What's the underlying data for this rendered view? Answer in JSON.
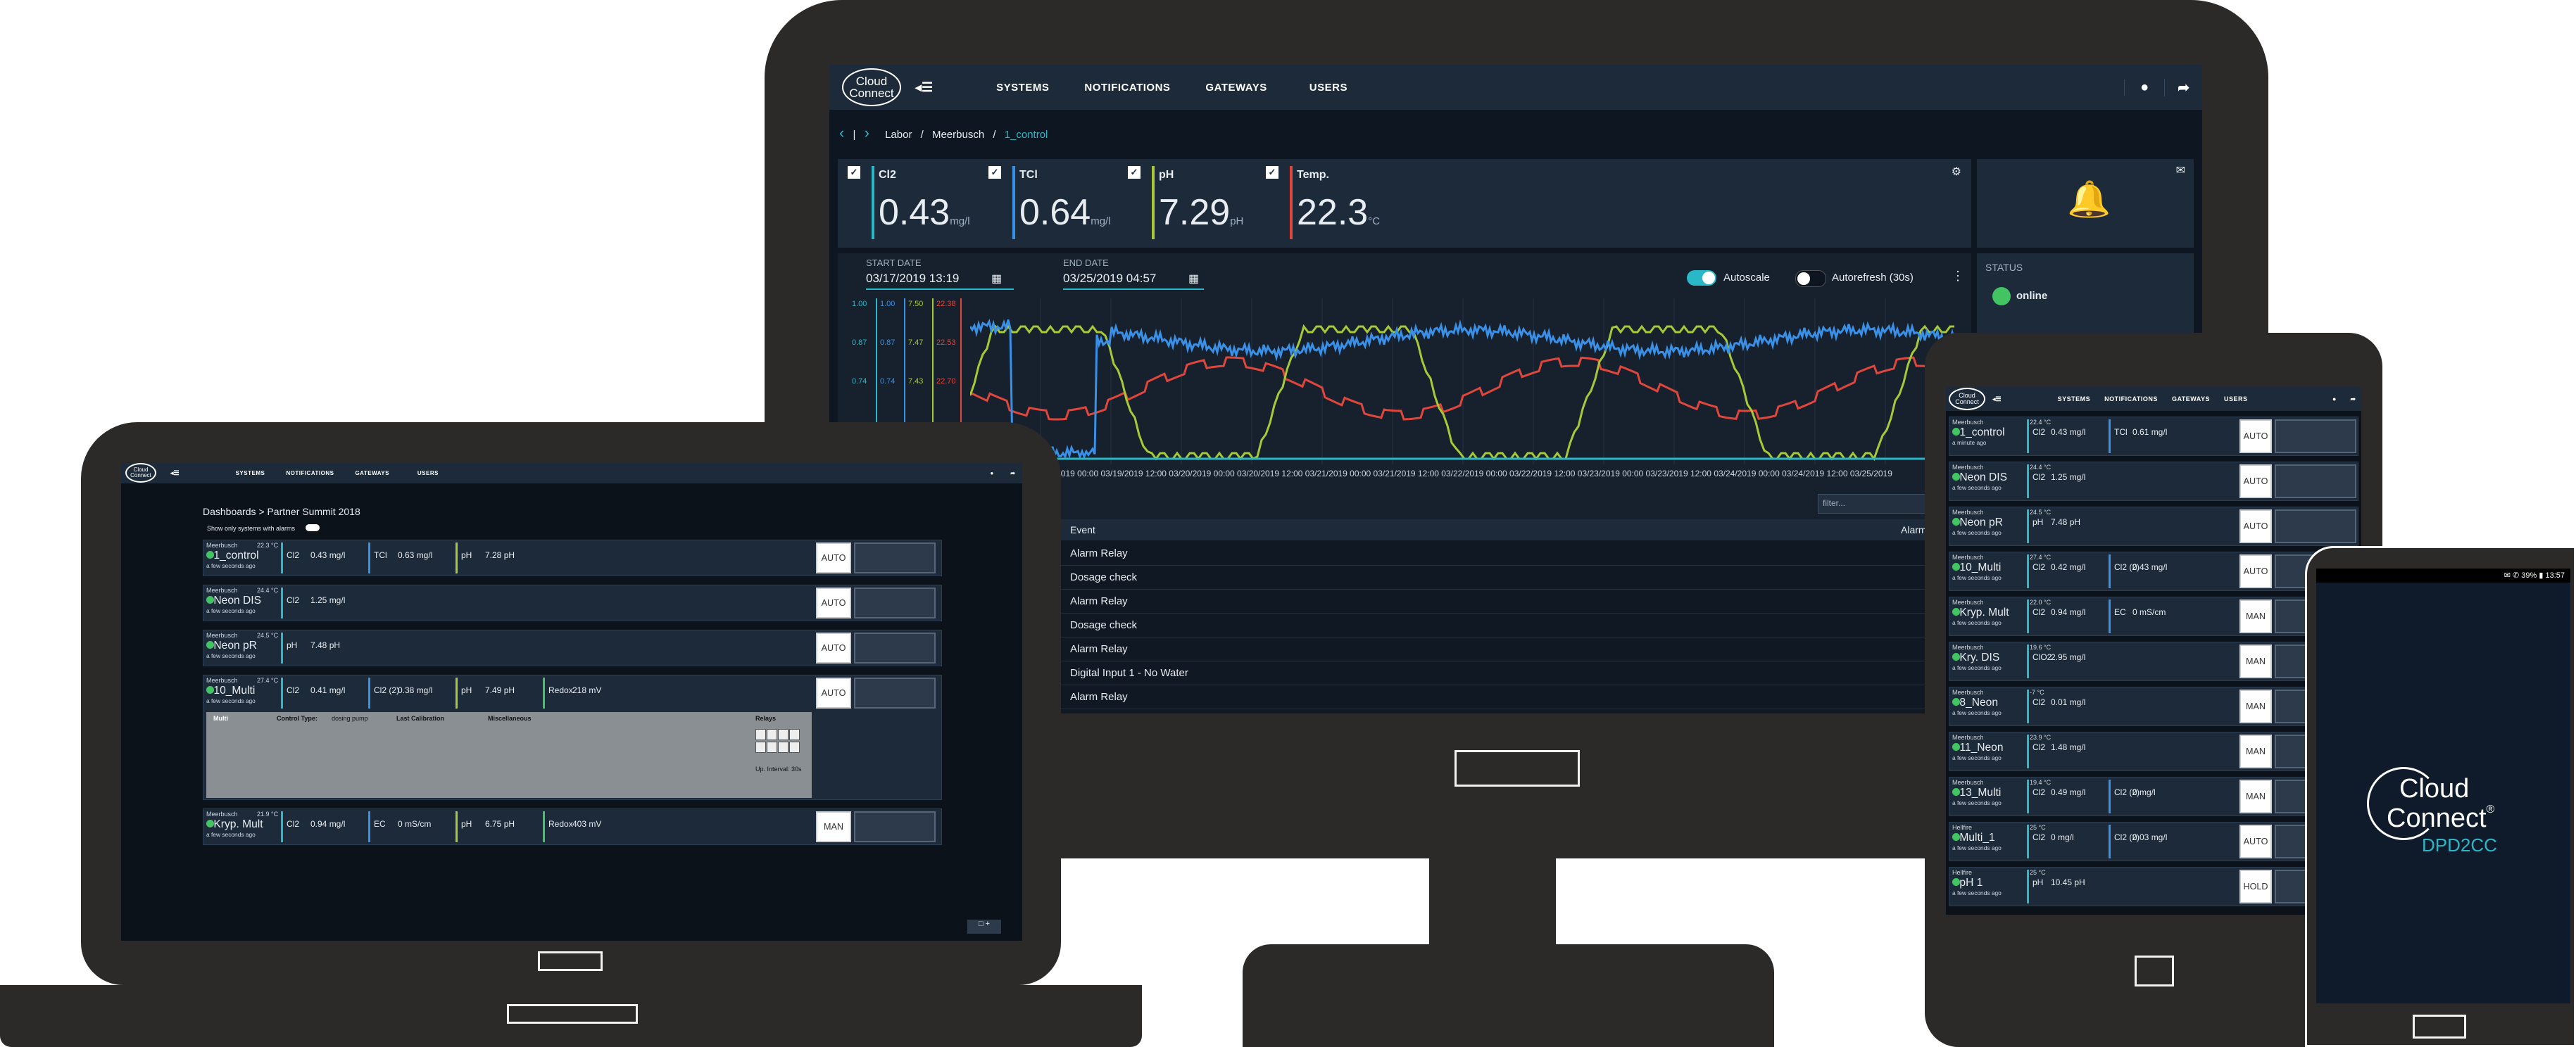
{
  "brand": {
    "line1": "Cloud",
    "line2": "Connect",
    "tm": "®",
    "product": "DPD2CC"
  },
  "nav": {
    "menu_icon": "◂☰",
    "systems": "SYSTEMS",
    "notifications": "NOTIFICATIONS",
    "gateways": "GATEWAYS",
    "users": "USERS"
  },
  "monitor": {
    "breadcrumb": {
      "prev": "‹",
      "sep1": "|",
      "next": "›",
      "c1": "Labor",
      "s1": "/",
      "c2": "Meerbusch",
      "s2": "/",
      "c3": "1_control"
    },
    "readings": [
      {
        "label": "Cl2",
        "value": "0.43",
        "unit": "mg/l",
        "color": "#2ab7c8"
      },
      {
        "label": "TCl",
        "value": "0.64",
        "unit": "mg/l",
        "color": "#3a8fe6"
      },
      {
        "label": "pH",
        "value": "7.29",
        "unit": "pH",
        "color": "#a7c937"
      },
      {
        "label": "Temp.",
        "value": "22.3",
        "unit": "°C",
        "color": "#e0463b"
      }
    ],
    "start_label": "START DATE",
    "start_value": "03/17/2019 13:19",
    "end_label": "END DATE",
    "end_value": "03/25/2019 04:57",
    "autoscale": "Autoscale",
    "autorefresh": "Autorefresh (30s)",
    "status_label": "STATUS",
    "status_value": "online",
    "axis_rows": [
      [
        "1.00",
        "1.00",
        "7.50",
        "22.38"
      ],
      [
        "0.87",
        "0.87",
        "7.47",
        "22.53"
      ],
      [
        "0.74",
        "0.74",
        "7.43",
        "22.70"
      ]
    ],
    "x_ticks": "03/18/2019 12:00 03/19/2019 00:00 03/19/2019 12:00 03/20/2019 00:00 03/20/2019 12:00 03/21/2019 00:00 03/21/2019 12:00 03/22/2019 00:00 03/22/2019 12:00 03/23/2019 00:00 03/23/2019 12:00 03/24/2019 00:00 03/24/2019 12:00 03/25/2019",
    "filter_placeholder": "filter...",
    "event_header": "Event",
    "alarm_header": "Alarm",
    "events": [
      "Alarm Relay",
      "Dosage check",
      "Alarm Relay",
      "Dosage check",
      "Alarm Relay",
      "Digital Input 1 - No Water",
      "Alarm Relay"
    ]
  },
  "laptop": {
    "title": "Dashboards > Partner Summit 2018",
    "toggle_label": "Show only systems with alarms",
    "systems": [
      {
        "site": "Meerbusch",
        "temp": "22.3 °C",
        "name": "1_control",
        "ago": "a few seconds ago",
        "m1": "Cl2",
        "v1": "0.43 mg/l",
        "m2": "TCl",
        "v2": "0.63 mg/l",
        "m3": "pH",
        "v3": "7.28 pH",
        "mode": "AUTO"
      },
      {
        "site": "Meerbusch",
        "temp": "24.4 °C",
        "name": "Neon DIS",
        "ago": "a few seconds ago",
        "m1": "Cl2",
        "v1": "1.25 mg/l",
        "mode": "AUTO"
      },
      {
        "site": "Meerbusch",
        "temp": "24.5 °C",
        "name": "Neon pR",
        "ago": "a few seconds ago",
        "m1": "pH",
        "v1": "7.48 pH",
        "mode": "AUTO"
      },
      {
        "site": "Meerbusch",
        "temp": "27.4 °C",
        "name": "10_Multi",
        "ago": "a few seconds ago",
        "m1": "Cl2",
        "v1": "0.41 mg/l",
        "m2": "Cl2 (2)",
        "v2": "0.38 mg/l",
        "m3": "pH",
        "v3": "7.49 pH",
        "m4": "Redox",
        "v4": "218 mV",
        "mode": "AUTO"
      },
      {
        "site": "Meerbusch",
        "temp": "21.9 °C",
        "name": "Kryp. Mult",
        "ago": "a few seconds ago",
        "m1": "Cl2",
        "v1": "0.94 mg/l",
        "m2": "EC",
        "v2": "0 mS/cm",
        "m3": "pH",
        "v3": "6.75 pH",
        "m4": "Redox",
        "v4": "403 mV",
        "mode": "MAN"
      }
    ],
    "detail": {
      "name": "Multi",
      "control_type": "Control Type:",
      "control_val": "dosing pump",
      "last_cal": "Last Calibration",
      "misc": "Miscellaneous",
      "relays": "Relays",
      "interval": "Up. Interval: 30s"
    }
  },
  "tablet": {
    "systems": [
      {
        "site": "Meerbusch",
        "temp": "22.4 °C",
        "name": "1_control",
        "ago": "a minute ago",
        "m1": "Cl2",
        "v1": "0.43 mg/l",
        "m2": "TCl",
        "v2": "0.61 mg/l",
        "mode": "AUTO"
      },
      {
        "site": "Meerbusch",
        "temp": "24.4 °C",
        "name": "Neon DIS",
        "ago": "a few seconds ago",
        "m1": "Cl2",
        "v1": "1.25 mg/l",
        "mode": "AUTO"
      },
      {
        "site": "Meerbusch",
        "temp": "24.5 °C",
        "name": "Neon pR",
        "ago": "a few seconds ago",
        "m1": "pH",
        "v1": "7.48 pH",
        "mode": "AUTO"
      },
      {
        "site": "Meerbusch",
        "temp": "27.4 °C",
        "name": "10_Multi",
        "ago": "a few seconds ago",
        "m1": "Cl2",
        "v1": "0.42 mg/l",
        "m2": "Cl2 (2)",
        "v2": "0.43 mg/l",
        "mode": "AUTO"
      },
      {
        "site": "Meerbusch",
        "temp": "22.0 °C",
        "name": "Kryp. Mult",
        "ago": "a few seconds ago",
        "m1": "Cl2",
        "v1": "0.94 mg/l",
        "m2": "EC",
        "v2": "0 mS/cm",
        "mode": "MAN"
      },
      {
        "site": "Meerbusch",
        "temp": "19.6 °C",
        "name": "Kry. DIS",
        "ago": "a few seconds ago",
        "m1": "ClO2",
        "v1": "2.95 mg/l",
        "mode": "MAN"
      },
      {
        "site": "Meerbusch",
        "temp": "-7 °C",
        "name": "8_Neon",
        "ago": "a few seconds ago",
        "m1": "Cl2",
        "v1": "0.01 mg/l",
        "mode": "MAN"
      },
      {
        "site": "Meerbusch",
        "temp": "23.9 °C",
        "name": "11_Neon",
        "ago": "a few seconds ago",
        "m1": "Cl2",
        "v1": "1.48 mg/l",
        "mode": "MAN"
      },
      {
        "site": "Meerbusch",
        "temp": "19.4 °C",
        "name": "13_Multi",
        "ago": "a few seconds ago",
        "m1": "Cl2",
        "v1": "0.49 mg/l",
        "m2": "Cl2 (2)",
        "v2": "0 mg/l",
        "mode": "MAN"
      },
      {
        "site": "Hellfire",
        "temp": "25 °C",
        "name": "Multi_1",
        "ago": "a few seconds ago",
        "m1": "Cl2",
        "v1": "0 mg/l",
        "m2": "Cl2 (2)",
        "v2": "0.03 mg/l",
        "mode": "AUTO"
      },
      {
        "site": "Hellfire",
        "temp": "25 °C",
        "name": "pH 1",
        "ago": "a few seconds ago",
        "m1": "pH",
        "v1": "10.45 pH",
        "mode": "HOLD"
      }
    ]
  },
  "phone": {
    "status": "✉ ✆ 39% ▮ 13:57"
  }
}
